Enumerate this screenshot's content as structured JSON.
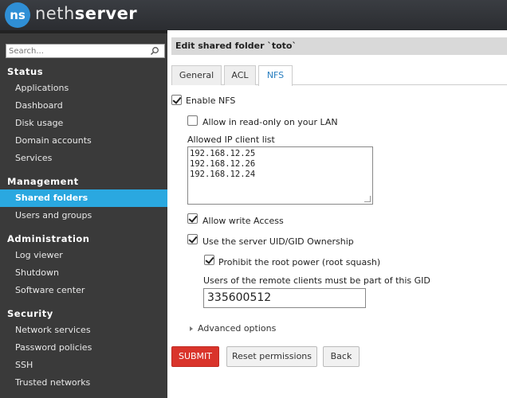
{
  "brand": {
    "logo": "ns",
    "name_part1": "neth",
    "name_part2": "server"
  },
  "search": {
    "placeholder": "Search..."
  },
  "sidebar": {
    "sections": [
      {
        "title": "Status",
        "items": [
          "Applications",
          "Dashboard",
          "Disk usage",
          "Domain accounts",
          "Services"
        ]
      },
      {
        "title": "Management",
        "items": [
          "Shared folders",
          "Users and groups"
        ]
      },
      {
        "title": "Administration",
        "items": [
          "Log viewer",
          "Shutdown",
          "Software center"
        ]
      },
      {
        "title": "Security",
        "items": [
          "Network services",
          "Password policies",
          "SSH",
          "Trusted networks"
        ]
      }
    ],
    "active_item": "Shared folders"
  },
  "page": {
    "title": "Edit shared folder `toto`"
  },
  "tabs": [
    {
      "label": "General",
      "active": false
    },
    {
      "label": "ACL",
      "active": false
    },
    {
      "label": "NFS",
      "active": true
    }
  ],
  "form": {
    "enable_nfs": {
      "label": "Enable NFS",
      "checked": true
    },
    "read_only": {
      "label": "Allow in read-only on your LAN",
      "checked": false
    },
    "ip_list": {
      "label": "Allowed IP client list",
      "values": [
        "192.168.12.25",
        "192.168.12.26",
        "192.168.12.24"
      ]
    },
    "write_access": {
      "label": "Allow write Access",
      "checked": true
    },
    "uid_gid": {
      "label": "Use the server UID/GID Ownership",
      "checked": true
    },
    "root_squash": {
      "label": "Prohibit the root power (root squash)",
      "checked": true
    },
    "gid": {
      "label": "Users of the remote clients must be part of this GID",
      "value": "335600512"
    },
    "advanced": "Advanced options"
  },
  "buttons": {
    "submit": "SUBMIT",
    "reset": "Reset permissions",
    "back": "Back"
  }
}
